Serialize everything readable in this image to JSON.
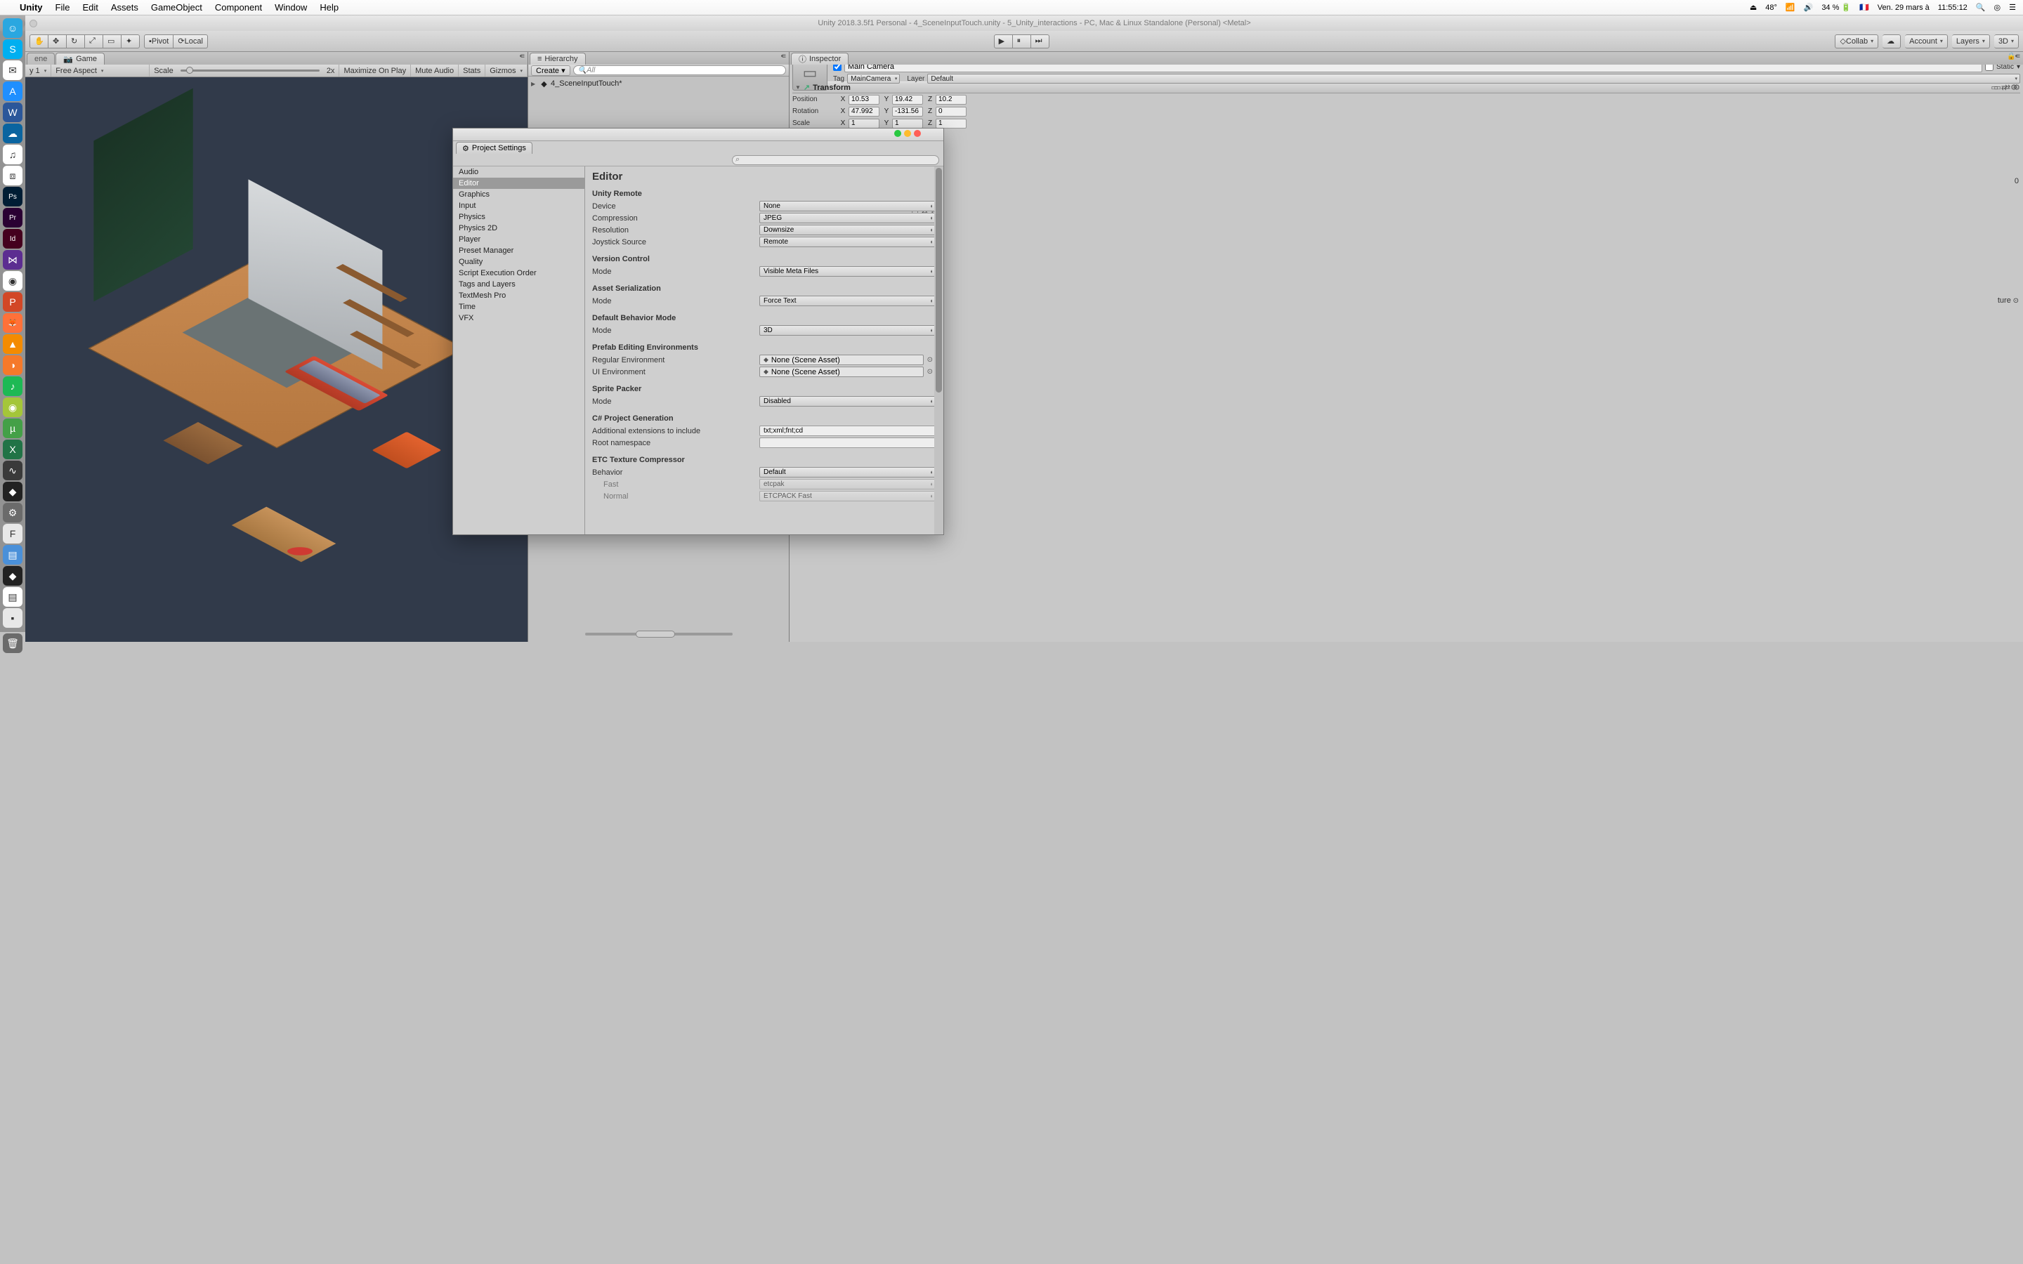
{
  "macmenu": {
    "app": "Unity",
    "items": [
      "File",
      "Edit",
      "Assets",
      "GameObject",
      "Component",
      "Window",
      "Help"
    ],
    "status": {
      "temp": "48°",
      "battery": "34 %",
      "flag": "🇫🇷",
      "date": "Ven. 29 mars à",
      "time": "11:55:12"
    }
  },
  "dock": [
    {
      "name": "finder",
      "bg": "#2aa7e0",
      "glyph": "☺"
    },
    {
      "name": "skype",
      "bg": "#00aff0",
      "glyph": "S"
    },
    {
      "name": "mail",
      "bg": "#ffffff",
      "glyph": "✉"
    },
    {
      "name": "appstore",
      "bg": "#1f8fff",
      "glyph": "A"
    },
    {
      "name": "word",
      "bg": "#2b579a",
      "glyph": "W"
    },
    {
      "name": "onedrive",
      "bg": "#0a64a0",
      "glyph": "☁"
    },
    {
      "name": "music",
      "bg": "#ffffff",
      "glyph": "♫"
    },
    {
      "name": "dropbox",
      "bg": "#ffffff",
      "glyph": "⧈"
    },
    {
      "name": "photoshop",
      "bg": "#001d34",
      "glyph": "Ps"
    },
    {
      "name": "premiere",
      "bg": "#2a0033",
      "glyph": "Pr"
    },
    {
      "name": "indesign",
      "bg": "#45001e",
      "glyph": "Id"
    },
    {
      "name": "visualstudio",
      "bg": "#5c2d91",
      "glyph": "⋈"
    },
    {
      "name": "chrome",
      "bg": "#ffffff",
      "glyph": "◉"
    },
    {
      "name": "powerpoint",
      "bg": "#d24726",
      "glyph": "P"
    },
    {
      "name": "firefox",
      "bg": "#ff7139",
      "glyph": "🦊"
    },
    {
      "name": "vlc",
      "bg": "#f48b00",
      "glyph": "▲"
    },
    {
      "name": "blender",
      "bg": "#f5792a",
      "glyph": "◑"
    },
    {
      "name": "spotify",
      "bg": "#1db954",
      "glyph": "♪"
    },
    {
      "name": "android",
      "bg": "#a4c639",
      "glyph": "◉"
    },
    {
      "name": "utorrent",
      "bg": "#44a047",
      "glyph": "µ"
    },
    {
      "name": "excel",
      "bg": "#217346",
      "glyph": "X"
    },
    {
      "name": "activity",
      "bg": "#3a3a3a",
      "glyph": "∿"
    },
    {
      "name": "unity",
      "bg": "#222",
      "glyph": "◆"
    },
    {
      "name": "sysprefs",
      "bg": "#6b6b6b",
      "glyph": "⚙"
    },
    {
      "name": "font",
      "bg": "#e8e8e8",
      "glyph": "F"
    },
    {
      "name": "preview",
      "bg": "#4a90d9",
      "glyph": "▤"
    },
    {
      "name": "unityhub",
      "bg": "#222",
      "glyph": "◆"
    },
    {
      "name": "notes",
      "bg": "#ffffff",
      "glyph": "▤"
    },
    {
      "name": "terminal",
      "bg": "#e8e8e8",
      "glyph": "▪"
    }
  ],
  "dock_trash": {
    "name": "trash",
    "bg": "#6b6b6b",
    "glyph": "🗑"
  },
  "window_title": "Unity 2018.3.5f1 Personal - 4_SceneInputTouch.unity - 5_Unity_interactions - PC, Mac & Linux Standalone (Personal) <Metal>",
  "toolbar": {
    "pivot": "Pivot",
    "local": "Local",
    "collab": "Collab",
    "account": "Account",
    "layers": "Layers",
    "layout": "3D"
  },
  "gamepanel": {
    "tabs": {
      "scene": "ene",
      "game": "Game"
    },
    "display": "y 1",
    "aspect": "Free Aspect",
    "scale_label": "Scale",
    "scale_val": "2x",
    "maximize": "Maximize On Play",
    "mute": "Mute Audio",
    "stats": "Stats",
    "gizmos": "Gizmos"
  },
  "hierarchy": {
    "title": "Hierarchy",
    "create": "Create",
    "search_ph": "All",
    "scene": "4_SceneInputTouch*"
  },
  "inspector": {
    "title": "Inspector",
    "objname": "Main Camera",
    "static": "Static",
    "tag_l": "Tag",
    "tag_v": "MainCamera",
    "layer_l": "Layer",
    "layer_v": "Default",
    "transform": {
      "title": "Transform",
      "pos_l": "Position",
      "rot_l": "Rotation",
      "scl_l": "Scale",
      "pos": {
        "x": "10.53",
        "y": "19.42",
        "z": "10.2"
      },
      "rot": {
        "x": "47.992",
        "y": "-131.56",
        "z": "0"
      },
      "scl": {
        "x": "1",
        "y": "1",
        "z": "1"
      }
    },
    "texture_lbl": "ture",
    "zero": "0"
  },
  "project_settings": {
    "tab": "Project Settings",
    "categories": [
      "Audio",
      "Editor",
      "Graphics",
      "Input",
      "Physics",
      "Physics 2D",
      "Player",
      "Preset Manager",
      "Quality",
      "Script Execution Order",
      "Tags and Layers",
      "TextMesh Pro",
      "Time",
      "VFX"
    ],
    "selected": "Editor",
    "heading": "Editor",
    "sections": [
      {
        "title": "Unity Remote",
        "rows": [
          {
            "label": "Device",
            "type": "dd",
            "value": "None"
          },
          {
            "label": "Compression",
            "type": "dd",
            "value": "JPEG"
          },
          {
            "label": "Resolution",
            "type": "dd",
            "value": "Downsize"
          },
          {
            "label": "Joystick Source",
            "type": "dd",
            "value": "Remote"
          }
        ]
      },
      {
        "title": "Version Control",
        "rows": [
          {
            "label": "Mode",
            "type": "dd",
            "value": "Visible Meta Files"
          }
        ]
      },
      {
        "title": "Asset Serialization",
        "rows": [
          {
            "label": "Mode",
            "type": "dd",
            "value": "Force Text"
          }
        ]
      },
      {
        "title": "Default Behavior Mode",
        "rows": [
          {
            "label": "Mode",
            "type": "dd",
            "value": "3D"
          }
        ]
      },
      {
        "title": "Prefab Editing Environments",
        "rows": [
          {
            "label": "Regular Environment",
            "type": "obj",
            "value": "None (Scene Asset)"
          },
          {
            "label": "UI Environment",
            "type": "obj",
            "value": "None (Scene Asset)"
          }
        ]
      },
      {
        "title": "Sprite Packer",
        "rows": [
          {
            "label": "Mode",
            "type": "dd",
            "value": "Disabled"
          }
        ]
      },
      {
        "title": "C# Project Generation",
        "rows": [
          {
            "label": "Additional extensions to include",
            "type": "txt",
            "value": "txt;xml;fnt;cd"
          },
          {
            "label": "Root namespace",
            "type": "txt",
            "value": ""
          }
        ]
      },
      {
        "title": "ETC Texture Compressor",
        "rows": [
          {
            "label": "Behavior",
            "type": "dd",
            "value": "Default"
          },
          {
            "label": "Fast",
            "type": "dd",
            "value": "etcpak",
            "indent": true,
            "disabled": true
          },
          {
            "label": "Normal",
            "type": "dd",
            "value": "ETCPACK Fast",
            "indent": true,
            "disabled": true
          }
        ]
      }
    ]
  }
}
